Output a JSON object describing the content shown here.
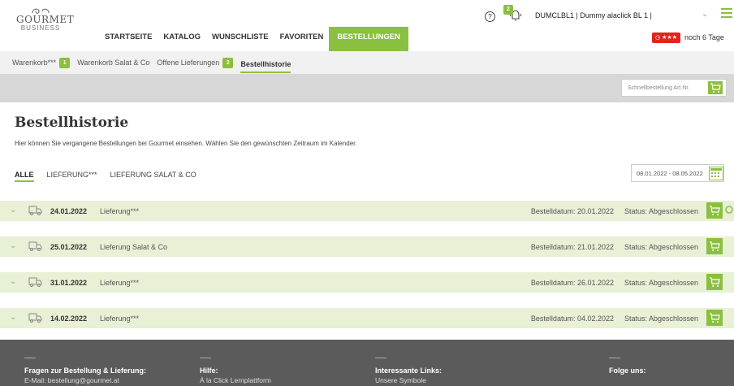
{
  "header": {
    "logo_text": "GOURMET",
    "logo_sub": "BUSINESS",
    "nav": [
      "STARTSEITE",
      "KATALOG",
      "WUNSCHLISTE",
      "FAVORITEN",
      "BESTELLUNGEN"
    ],
    "active_nav": "BESTELLUNGEN",
    "help_glyph": "?",
    "notification_count": "2",
    "user": "DUMCLBL1 | Dummy alaclick BL 1 |",
    "days_badge": "★★★",
    "days_text": "noch 6 Tage",
    "accent_color": "#8bbf3f"
  },
  "subnav": {
    "items": [
      {
        "label": "Warenkorb***",
        "count": "1"
      },
      {
        "label": "Warenkorb Salat & Co",
        "count": ""
      },
      {
        "label": "Offene Lieferungen",
        "count": "2"
      },
      {
        "label": "Bestellhistorie",
        "count": ""
      }
    ],
    "active": "Bestellhistorie"
  },
  "quickbar": {
    "placeholder": "Schnellbestellung Art.Nr."
  },
  "main": {
    "title": "Bestellhistorie",
    "intro": "Hier können Sie vergangene Bestellungen bei Gourmet einsehen. Wählen Sie den gewünschten Zeitraum im Kalender.",
    "filters": [
      "ALLE",
      "LIEFERUNG***",
      "LIEFERUNG SALAT & CO"
    ],
    "active_filter": "ALLE",
    "date_range": "08.01.2022 - 08.05.2022"
  },
  "orders": [
    {
      "date": "24.01.2022",
      "type": "Lieferung***",
      "bestelldatum": "Bestelldatum: 20.01.2022",
      "status": "Status: Abgeschlossen"
    },
    {
      "date": "25.01.2022",
      "type": "Lieferung Salat & Co",
      "bestelldatum": "Bestelldatum: 21.01.2022",
      "status": "Status: Abgeschlossen"
    },
    {
      "date": "31.01.2022",
      "type": "Lieferung***",
      "bestelldatum": "Bestelldatum: 26.01.2022",
      "status": "Status: Abgeschlossen"
    },
    {
      "date": "14.02.2022",
      "type": "Lieferung***",
      "bestelldatum": "Bestelldatum: 04.02.2022",
      "status": "Status: Abgeschlossen"
    }
  ],
  "footer": {
    "cols": [
      {
        "head": "Fragen zur Bestellung & Lieferung:",
        "text": "E-Mail: bestellung@gourmet.at"
      },
      {
        "head": "Hilfe:",
        "text": "À la Click Lernplattform"
      },
      {
        "head": "Interessante Links:",
        "text": "Unsere Symbole"
      },
      {
        "head": "Folge uns:",
        "text": ""
      }
    ]
  }
}
